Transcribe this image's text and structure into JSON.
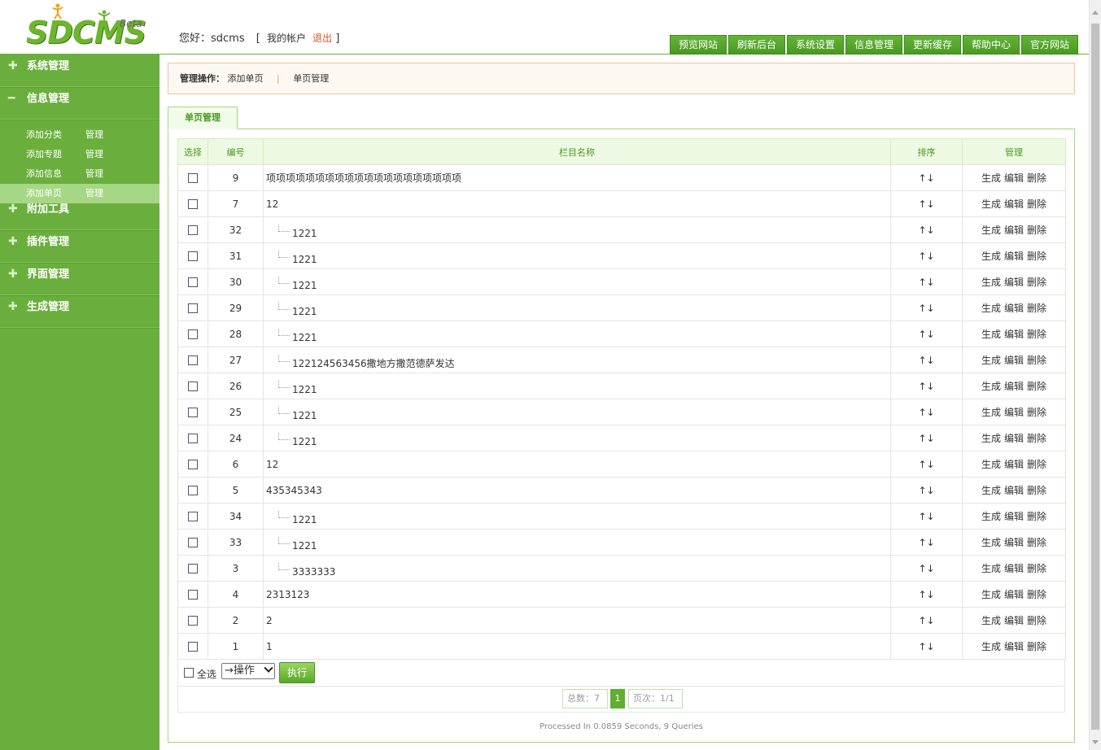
{
  "logo": {
    "text": "SDCMS",
    "beta": "Beta"
  },
  "user": {
    "greeting": "您好：sdcms",
    "bracket_open": "[",
    "account": "我的帐户",
    "logout": "退出",
    "bracket_close": "]"
  },
  "topnav": [
    "预览网站",
    "刷新后台",
    "系统设置",
    "信息管理",
    "更新缓存",
    "帮助中心",
    "官方网站"
  ],
  "sidebar": {
    "groups": [
      {
        "label": "系统管理",
        "icon": "plus-icon"
      },
      {
        "label": "信息管理",
        "icon": "minus-icon"
      },
      {
        "label": "附加工具",
        "icon": "plus-icon"
      },
      {
        "label": "插件管理",
        "icon": "plus-icon"
      },
      {
        "label": "界面管理",
        "icon": "plus-icon"
      },
      {
        "label": "生成管理",
        "icon": "plus-icon"
      }
    ],
    "sub_items": [
      {
        "label": "添加分类",
        "manage": "管理"
      },
      {
        "label": "添加专题",
        "manage": "管理"
      },
      {
        "label": "添加信息",
        "manage": "管理"
      },
      {
        "label": "添加单页",
        "manage": "管理"
      }
    ]
  },
  "opbar": {
    "label": "管理操作：",
    "add": "添加单页",
    "sep": "|",
    "manage": "单页管理"
  },
  "tab": "单页管理",
  "table": {
    "headers": [
      "选择",
      "编号",
      "栏目名称",
      "排序",
      "管理"
    ],
    "sort_label": "↑↓",
    "ops": [
      "生成",
      "编辑",
      "删除"
    ],
    "rows": [
      {
        "id": "9",
        "name": "项项项项项项项项项项项项项项项项项项项项",
        "child": false
      },
      {
        "id": "7",
        "name": "12",
        "child": false
      },
      {
        "id": "32",
        "name": "1221",
        "child": true
      },
      {
        "id": "31",
        "name": "1221",
        "child": true
      },
      {
        "id": "30",
        "name": "1221",
        "child": true
      },
      {
        "id": "29",
        "name": "1221",
        "child": true
      },
      {
        "id": "28",
        "name": "1221",
        "child": true
      },
      {
        "id": "27",
        "name": "122124563456撒地方撒范德萨发达",
        "child": true
      },
      {
        "id": "26",
        "name": "1221",
        "child": true
      },
      {
        "id": "25",
        "name": "1221",
        "child": true
      },
      {
        "id": "24",
        "name": "1221",
        "child": true
      },
      {
        "id": "6",
        "name": "12",
        "child": false
      },
      {
        "id": "5",
        "name": "435345343",
        "child": false
      },
      {
        "id": "34",
        "name": "1221",
        "child": true
      },
      {
        "id": "33",
        "name": "1221",
        "child": true
      },
      {
        "id": "3",
        "name": "3333333",
        "child": true
      },
      {
        "id": "4",
        "name": "2313123",
        "child": false
      },
      {
        "id": "2",
        "name": "2",
        "child": false
      },
      {
        "id": "1",
        "name": "1",
        "child": false
      }
    ]
  },
  "bulk": {
    "select_all": "全选",
    "action_select": "→操作",
    "execute": "执行"
  },
  "pager": {
    "total": "总数：7",
    "current": "1",
    "pages": "页次：1/1"
  },
  "footer": "Processed In 0.0859 Seconds, 9 Queries"
}
